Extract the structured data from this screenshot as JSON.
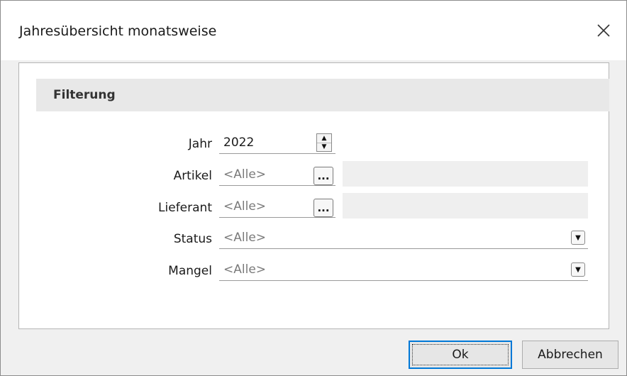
{
  "window": {
    "title": "Jahresübersicht monatsweise",
    "close_icon": "close-icon"
  },
  "group": {
    "label": "Filterung"
  },
  "form": {
    "jahr": {
      "label": "Jahr",
      "value": "2022"
    },
    "artikel": {
      "label": "Artikel",
      "value": "<Alle>",
      "button": "..."
    },
    "lieferant": {
      "label": "Lieferant",
      "value": "<Alle>",
      "button": "..."
    },
    "status": {
      "label": "Status",
      "value": "<Alle>"
    },
    "mangel": {
      "label": "Mangel",
      "value": "<Alle>"
    }
  },
  "buttons": {
    "ok": "Ok",
    "cancel": "Abbrechen"
  },
  "colors": {
    "accent": "#0078d7",
    "titlebar": "#ffffff",
    "background": "#f0f0f0"
  }
}
